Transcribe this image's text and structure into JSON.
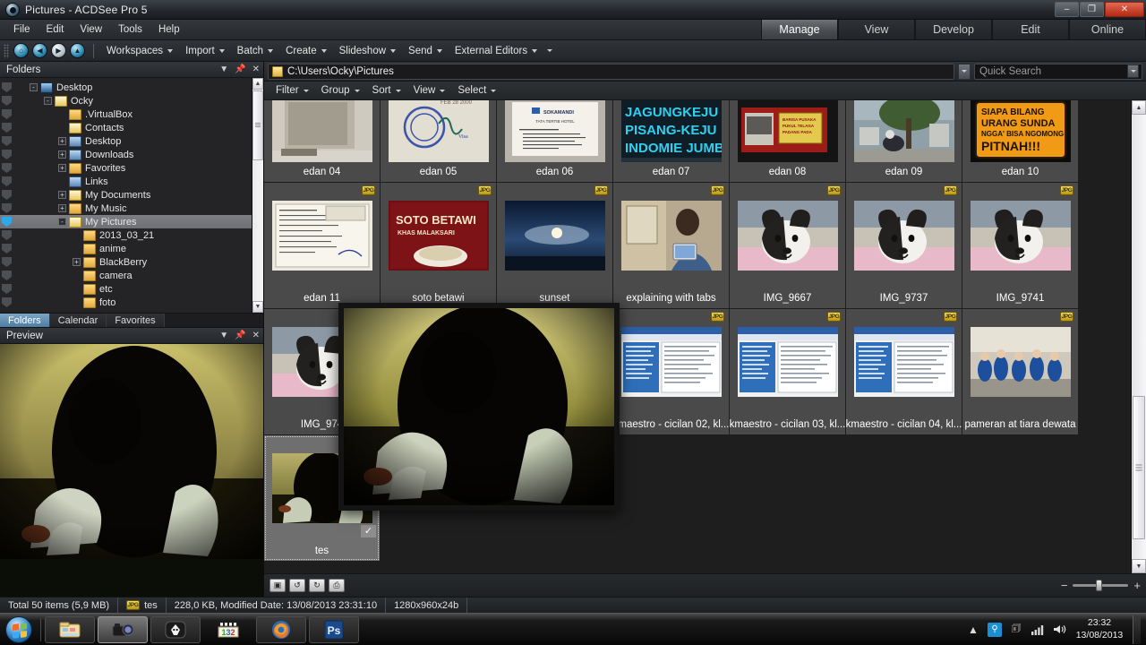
{
  "window": {
    "title": "Pictures - ACDSee Pro 5",
    "icon": "acdsee-icon",
    "minimize": "–",
    "maximize": "❐",
    "close": "✕"
  },
  "menubar": {
    "items": [
      "File",
      "Edit",
      "View",
      "Tools",
      "Help"
    ]
  },
  "mode_tabs": {
    "items": [
      "Manage",
      "View",
      "Develop",
      "Edit",
      "Online"
    ],
    "active": "Manage"
  },
  "toolbar": {
    "nav_buttons": [
      "home-icon",
      "back-icon",
      "forward-icon",
      "up-icon"
    ],
    "menus": [
      "Workspaces",
      "Import",
      "Batch",
      "Create",
      "Slideshow",
      "Send",
      "External Editors"
    ],
    "overflow": "chevron-down-icon"
  },
  "folders_pane": {
    "title": "Folders",
    "tools": [
      "dropdown-icon",
      "pin-icon",
      "close-icon"
    ],
    "tree": [
      {
        "label": "Desktop",
        "depth": 0,
        "expander": "-",
        "icon": "screen",
        "selected": false
      },
      {
        "label": "Ocky",
        "depth": 1,
        "expander": "-",
        "icon": "doc",
        "selected": false
      },
      {
        "label": ".VirtualBox",
        "depth": 2,
        "expander": "",
        "icon": "folder",
        "selected": false
      },
      {
        "label": "Contacts",
        "depth": 2,
        "expander": "",
        "icon": "doc",
        "selected": false
      },
      {
        "label": "Desktop",
        "depth": 2,
        "expander": "+",
        "icon": "blue",
        "selected": false
      },
      {
        "label": "Downloads",
        "depth": 2,
        "expander": "+",
        "icon": "blue",
        "selected": false
      },
      {
        "label": "Favorites",
        "depth": 2,
        "expander": "+",
        "icon": "folder",
        "selected": false
      },
      {
        "label": "Links",
        "depth": 2,
        "expander": "",
        "icon": "blue",
        "selected": false
      },
      {
        "label": "My Documents",
        "depth": 2,
        "expander": "+",
        "icon": "doc",
        "selected": false
      },
      {
        "label": "My Music",
        "depth": 2,
        "expander": "+",
        "icon": "folder",
        "selected": false
      },
      {
        "label": "My Pictures",
        "depth": 2,
        "expander": "-",
        "icon": "doc",
        "selected": true
      },
      {
        "label": "2013_03_21",
        "depth": 3,
        "expander": "",
        "icon": "folder",
        "selected": false
      },
      {
        "label": "anime",
        "depth": 3,
        "expander": "",
        "icon": "folder",
        "selected": false
      },
      {
        "label": "BlackBerry",
        "depth": 3,
        "expander": "+",
        "icon": "folder",
        "selected": false
      },
      {
        "label": "camera",
        "depth": 3,
        "expander": "",
        "icon": "folder",
        "selected": false
      },
      {
        "label": "etc",
        "depth": 3,
        "expander": "",
        "icon": "folder",
        "selected": false
      },
      {
        "label": "foto",
        "depth": 3,
        "expander": "",
        "icon": "folder",
        "selected": false
      }
    ]
  },
  "left_tabs": {
    "items": [
      "Folders",
      "Calendar",
      "Favorites"
    ],
    "active": "Folders"
  },
  "preview_pane": {
    "title": "Preview",
    "tools": [
      "dropdown-icon",
      "pin-icon",
      "close-icon"
    ]
  },
  "address_bar": {
    "path": "C:\\Users\\Ocky\\Pictures",
    "icon": "folder-icon",
    "dropdown": "chevron-down-icon"
  },
  "search": {
    "placeholder": "Quick Search",
    "value": "",
    "dropdown": "chevron-down-icon"
  },
  "filter_bar": {
    "items": [
      "Filter",
      "Group",
      "Sort",
      "View",
      "Select"
    ]
  },
  "thumbnails": [
    {
      "label": "edan 04",
      "jpg": false,
      "partial": true,
      "selected": false,
      "img": "doc-wall"
    },
    {
      "label": "edan 05",
      "jpg": false,
      "partial": true,
      "selected": false,
      "img": "stamp"
    },
    {
      "label": "edan 06",
      "jpg": false,
      "partial": true,
      "selected": false,
      "img": "hotel-rules"
    },
    {
      "label": "edan 07",
      "jpg": false,
      "partial": true,
      "selected": false,
      "img": "blue-sign"
    },
    {
      "label": "edan 08",
      "jpg": false,
      "partial": true,
      "selected": false,
      "img": "red-poster"
    },
    {
      "label": "edan 09",
      "jpg": false,
      "partial": true,
      "selected": false,
      "img": "street-tree"
    },
    {
      "label": "edan 10",
      "jpg": false,
      "partial": true,
      "selected": false,
      "img": "orange-sign"
    },
    {
      "label": "edan 11",
      "jpg": true,
      "partial": false,
      "selected": false,
      "img": "form-paper"
    },
    {
      "label": "soto betawi",
      "jpg": true,
      "partial": false,
      "selected": false,
      "img": "soto"
    },
    {
      "label": "sunset",
      "jpg": true,
      "partial": false,
      "selected": false,
      "img": "sky"
    },
    {
      "label": "explaining with tabs",
      "jpg": true,
      "partial": false,
      "selected": false,
      "img": "person-tab"
    },
    {
      "label": "IMG_9667",
      "jpg": true,
      "partial": false,
      "selected": false,
      "img": "dog1"
    },
    {
      "label": "IMG_9737",
      "jpg": true,
      "partial": false,
      "selected": false,
      "img": "dog2"
    },
    {
      "label": "IMG_9741",
      "jpg": true,
      "partial": false,
      "selected": false,
      "img": "dog3"
    },
    {
      "label": "IMG_974",
      "jpg": true,
      "partial": false,
      "selected": false,
      "img": "dog4"
    },
    {
      "label": "",
      "jpg": false,
      "partial": false,
      "selected": false,
      "img": "hidden1"
    },
    {
      "label": "",
      "jpg": false,
      "partial": false,
      "selected": false,
      "img": "hidden2"
    },
    {
      "label": "kmaestro - cicilan 02, kl...",
      "jpg": true,
      "partial": false,
      "selected": false,
      "img": "screenshot"
    },
    {
      "label": "kmaestro - cicilan 03, kl...",
      "jpg": true,
      "partial": false,
      "selected": false,
      "img": "screenshot"
    },
    {
      "label": "kmaestro - cicilan 04, kl...",
      "jpg": true,
      "partial": false,
      "selected": false,
      "img": "screenshot"
    },
    {
      "label": "pameran at tiara dewata",
      "jpg": true,
      "partial": false,
      "selected": false,
      "img": "expo"
    },
    {
      "label": "tes",
      "jpg": false,
      "partial": false,
      "selected": true,
      "img": "tes-dark"
    }
  ],
  "grid_footer": {
    "buttons": [
      "rotate-photo-icon",
      "rotate-left-icon",
      "rotate-right-icon",
      "print-icon"
    ],
    "zoom": {
      "minus": "−",
      "plus": "+",
      "value": 42
    }
  },
  "status_bar": {
    "total": "Total 50 items  (5,9 MB)",
    "file_badge": "JPG",
    "file_name": "tes",
    "file_info": "228,0 KB, Modified Date: 13/08/2013 23:31:10",
    "dimensions": "1280x960x24b"
  },
  "taskbar": {
    "start": "start-orb",
    "buttons": [
      {
        "name": "explorer-icon",
        "active": false
      },
      {
        "name": "acdsee-icon",
        "active": true
      },
      {
        "name": "foobar-icon",
        "active": false
      },
      {
        "name": "klite-321-icon",
        "active": false
      },
      {
        "name": "firefox-icon",
        "active": false
      },
      {
        "name": "photoshop-icon",
        "active": false
      }
    ],
    "tray": [
      "show-hidden-icon",
      "network-icon",
      "action-center-icon",
      "signal-icon",
      "volume-icon"
    ],
    "clock_time": "23:32",
    "clock_date": "13/08/2013"
  }
}
